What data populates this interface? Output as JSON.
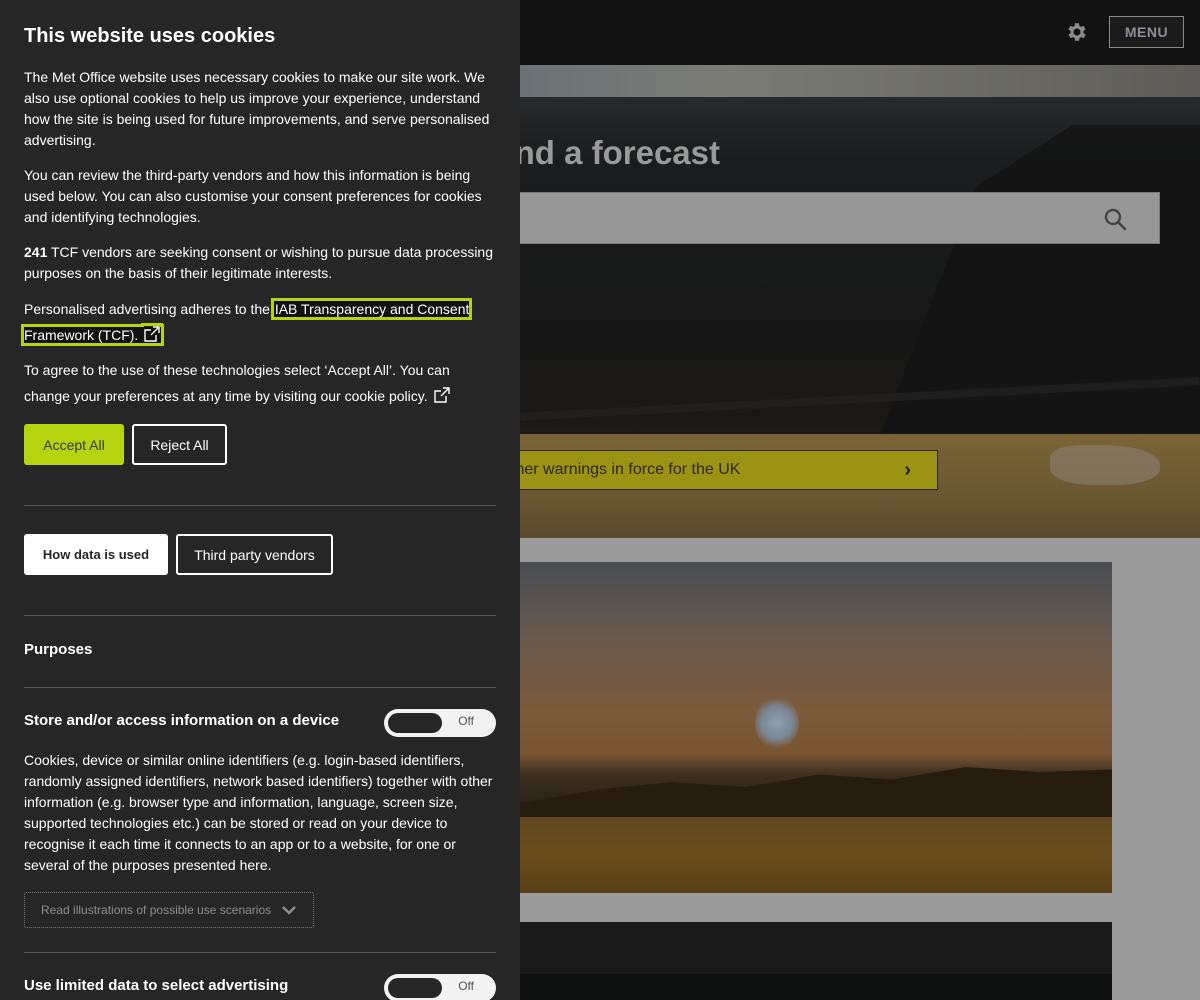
{
  "background_page": {
    "header": {
      "settings_icon": "gear-icon",
      "menu_label": "MENU"
    },
    "hero": {
      "title_partial": "nd a forecast",
      "search_icon": "search-icon",
      "search_value": ""
    },
    "warning_bar": {
      "label_partial": "ther warnings in force for the UK",
      "chevron_icon": "chevron-right-icon"
    }
  },
  "cookie_banner": {
    "title": "This website uses cookies",
    "paragraph_1": "The Met Office website uses necessary cookies to make our site work. We also use optional cookies to help us improve your experience, understand how the site is being used for future improvements, and serve personalised advertising.",
    "paragraph_2": "You can review the third-party vendors and how this information is being used below. You can also customise your consent preferences for cookies and identifying technologies.",
    "vendor_count": "241",
    "paragraph_3_rest": " TCF vendors are seeking consent or wishing to pursue data processing purposes on the basis of their legitimate interests.",
    "paragraph_4_prefix": "Personalised advertising adheres to the ",
    "tcf_link": "IAB Transparency and Consent Framework (TCF).",
    "paragraph_5": "To agree to the use of these technologies select ‘Accept All’. You can change your preferences at any time by visiting our cookie policy.",
    "accept_label": "Accept All",
    "reject_label": "Reject All",
    "tabs": [
      {
        "label": "How data is used",
        "active": true
      },
      {
        "label": "Third party vendors",
        "active": false
      }
    ],
    "purposes_heading": "Purposes",
    "purposes": [
      {
        "title": "Store and/or access information on a device",
        "toggle_state": "Off",
        "description": "Cookies, device or similar online identifiers (e.g. login-based identifiers, randomly assigned identifiers, network based identifiers) together with other information (e.g. browser type and information, language, screen size, supported technologies etc.) can be stored or read on your device to recognise it each time it connects to an app or to a website, for one or several of the purposes presented here.",
        "scenarios_label": "Read illustrations of possible use scenarios"
      },
      {
        "title": "Use limited data to select advertising",
        "toggle_state": "Off"
      }
    ],
    "colors": {
      "accent": "#b5d40f",
      "panel_bg": "#262626",
      "warning": "#9c9214"
    }
  }
}
